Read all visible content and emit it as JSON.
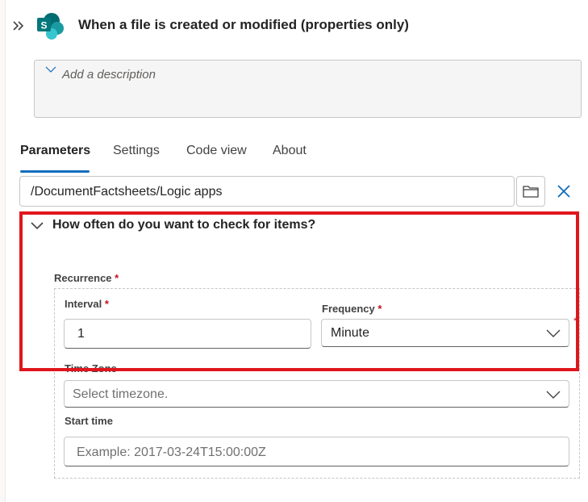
{
  "header": {
    "title": "When a file is created or modified (properties only)",
    "logo_letter": "S"
  },
  "description": {
    "placeholder": "Add a description"
  },
  "tabs": [
    {
      "label": "Parameters",
      "active": true
    },
    {
      "label": "Settings",
      "active": false
    },
    {
      "label": "Code view",
      "active": false
    },
    {
      "label": "About",
      "active": false
    }
  ],
  "folder": {
    "value": "/DocumentFactsheets/Logic apps"
  },
  "section": {
    "title": "How often do you want to check for items?",
    "recurrence_label": "Recurrence",
    "interval_label": "Interval",
    "interval_value": "1",
    "frequency_label": "Frequency",
    "frequency_value": "Minute",
    "timezone_label": "Time Zone",
    "timezone_placeholder": "Select timezone.",
    "start_time_label": "Start time",
    "start_time_placeholder": "Example: 2017-03-24T15:00:00Z",
    "required_mark": "*"
  },
  "colors": {
    "accent": "#0f6cbd",
    "highlight_frame": "#e0161d",
    "sharepoint": "#038387"
  }
}
